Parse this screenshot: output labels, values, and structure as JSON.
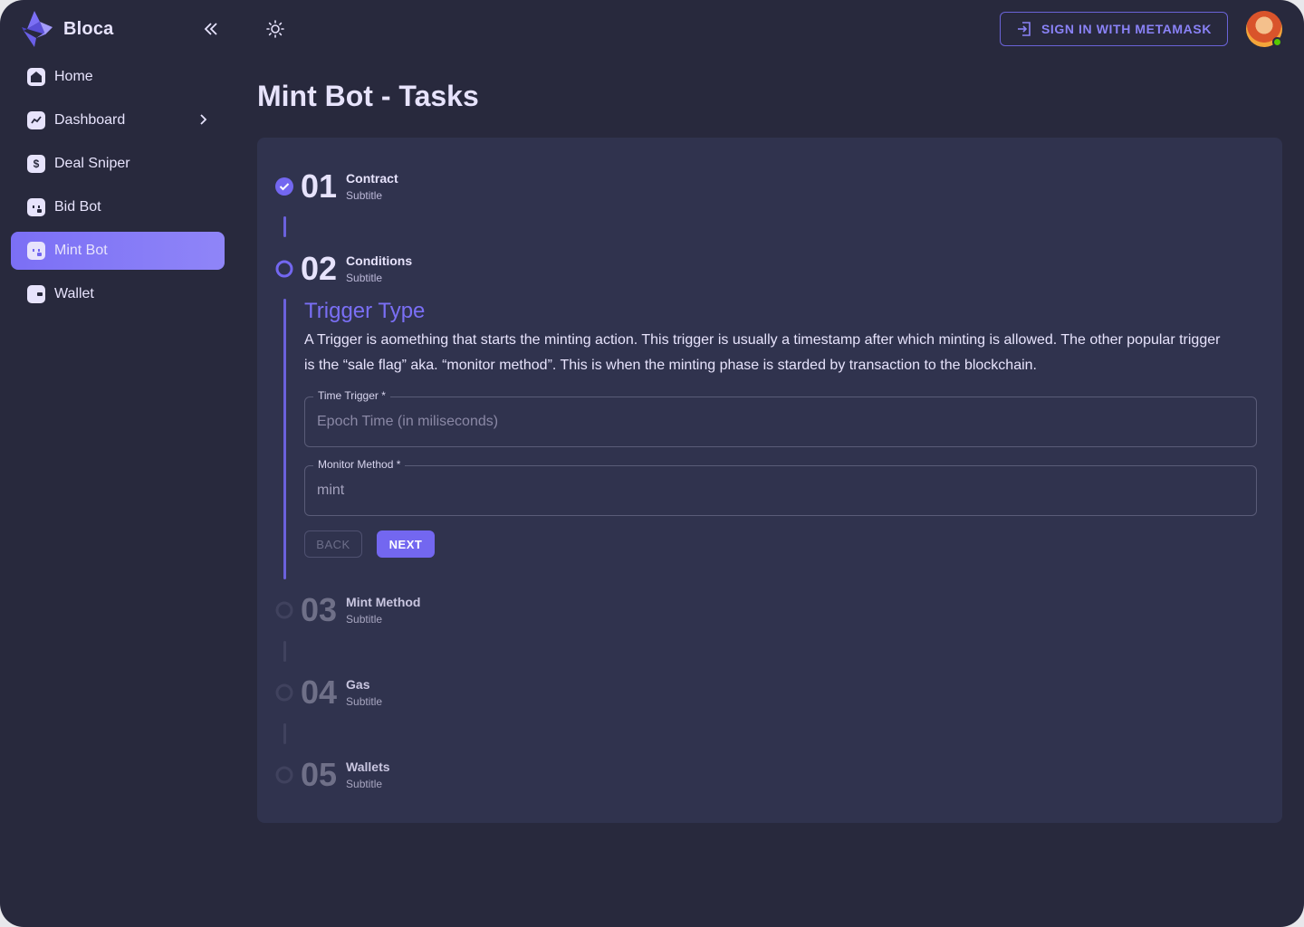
{
  "brand": {
    "name": "Bloca"
  },
  "sidebar": {
    "items": [
      {
        "label": "Home",
        "icon": "home-icon"
      },
      {
        "label": "Dashboard",
        "icon": "chart-icon"
      },
      {
        "label": "Deal Sniper",
        "icon": "dollar-icon"
      },
      {
        "label": "Bid Bot",
        "icon": "bot-icon"
      },
      {
        "label": "Mint Bot",
        "icon": "bot-plus-icon",
        "active": true
      },
      {
        "label": "Wallet",
        "icon": "wallet-icon"
      }
    ]
  },
  "header": {
    "signin_label": "SIGN IN WITH METAMASK"
  },
  "page": {
    "title": "Mint Bot - Tasks"
  },
  "steps": [
    {
      "num": "01",
      "title": "Contract",
      "subtitle": "Subtitle",
      "state": "completed"
    },
    {
      "num": "02",
      "title": "Conditions",
      "subtitle": "Subtitle",
      "state": "active"
    },
    {
      "num": "03",
      "title": "Mint Method",
      "subtitle": "Subtitle",
      "state": "pending"
    },
    {
      "num": "04",
      "title": "Gas",
      "subtitle": "Subtitle",
      "state": "pending"
    },
    {
      "num": "05",
      "title": "Wallets",
      "subtitle": "Subtitle",
      "state": "pending"
    }
  ],
  "conditions": {
    "heading": "Trigger Type",
    "description": "A Trigger is aomething that starts the minting action. This trigger is usually a timestamp after which minting is allowed. The other popular trigger is the “sale flag” aka. “monitor method”. This is when the minting phase is starded by transaction to the blockchain.",
    "time_trigger": {
      "label": "Time Trigger *",
      "placeholder": "Epoch Time (in miliseconds)",
      "value": ""
    },
    "monitor_method": {
      "label": "Monitor Method *",
      "value": "mint"
    },
    "back_label": "BACK",
    "next_label": "NEXT"
  },
  "colors": {
    "accent": "#7367f0",
    "background": "#28293d",
    "card": "#30334e"
  }
}
